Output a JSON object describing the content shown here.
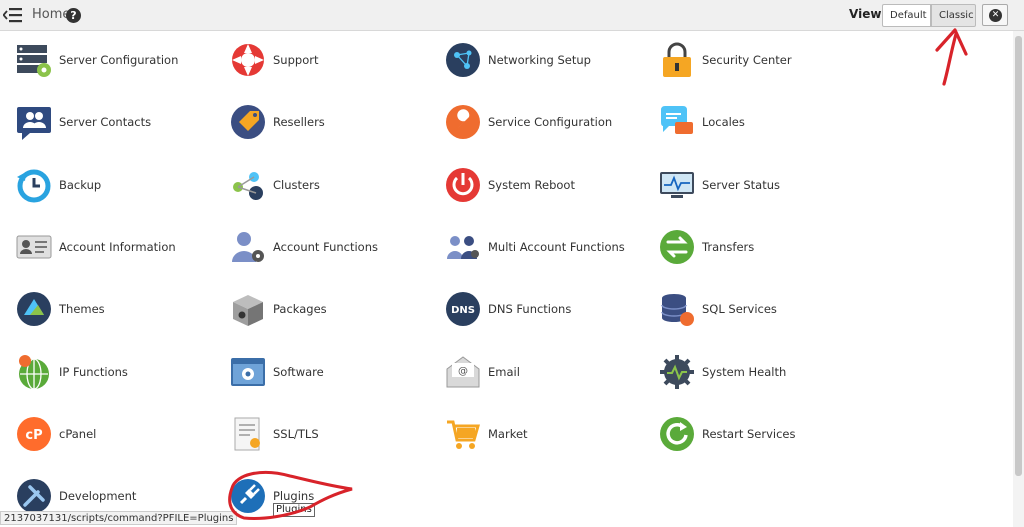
{
  "header": {
    "home_label": "Home",
    "help_glyph": "?",
    "view_label": "View:",
    "default_button": "Default",
    "classic_button": "Classic"
  },
  "tiles": [
    {
      "label": "Server Configuration",
      "icon": "server-configuration-icon"
    },
    {
      "label": "Support",
      "icon": "lifebuoy-icon"
    },
    {
      "label": "Networking Setup",
      "icon": "network-globe-icon"
    },
    {
      "label": "Security Center",
      "icon": "padlock-icon"
    },
    {
      "label": "Server Contacts",
      "icon": "contacts-icon"
    },
    {
      "label": "Resellers",
      "icon": "tag-icon"
    },
    {
      "label": "Service Configuration",
      "icon": "wrench-icon"
    },
    {
      "label": "Locales",
      "icon": "speech-bubble-icon"
    },
    {
      "label": "Backup",
      "icon": "backup-clock-icon"
    },
    {
      "label": "Clusters",
      "icon": "clusters-icon"
    },
    {
      "label": "System Reboot",
      "icon": "power-icon"
    },
    {
      "label": "Server Status",
      "icon": "monitor-pulse-icon"
    },
    {
      "label": "Account Information",
      "icon": "id-card-icon"
    },
    {
      "label": "Account Functions",
      "icon": "user-gear-icon"
    },
    {
      "label": "Multi Account Functions",
      "icon": "multi-user-icon"
    },
    {
      "label": "Transfers",
      "icon": "transfer-arrows-icon"
    },
    {
      "label": "Themes",
      "icon": "themes-icon"
    },
    {
      "label": "Packages",
      "icon": "package-box-icon"
    },
    {
      "label": "DNS Functions",
      "icon": "dns-icon"
    },
    {
      "label": "SQL Services",
      "icon": "database-icon"
    },
    {
      "label": "IP Functions",
      "icon": "ip-globe-icon"
    },
    {
      "label": "Software",
      "icon": "software-window-icon"
    },
    {
      "label": "Email",
      "icon": "email-envelope-icon"
    },
    {
      "label": "System Health",
      "icon": "health-gear-icon"
    },
    {
      "label": "cPanel",
      "icon": "cpanel-logo-icon"
    },
    {
      "label": "SSL/TLS",
      "icon": "certificate-icon"
    },
    {
      "label": "Market",
      "icon": "shopping-cart-icon"
    },
    {
      "label": "Restart Services",
      "icon": "restart-icon"
    },
    {
      "label": "Development",
      "icon": "development-tools-icon"
    },
    {
      "label": "Plugins",
      "icon": "plug-icon"
    }
  ],
  "status_url": "2137037131/scripts/command?PFILE=Plugins",
  "tooltip": "Plugins",
  "colors": {
    "annotation_red": "#d8232a",
    "topbar": "#f0f0f0"
  }
}
